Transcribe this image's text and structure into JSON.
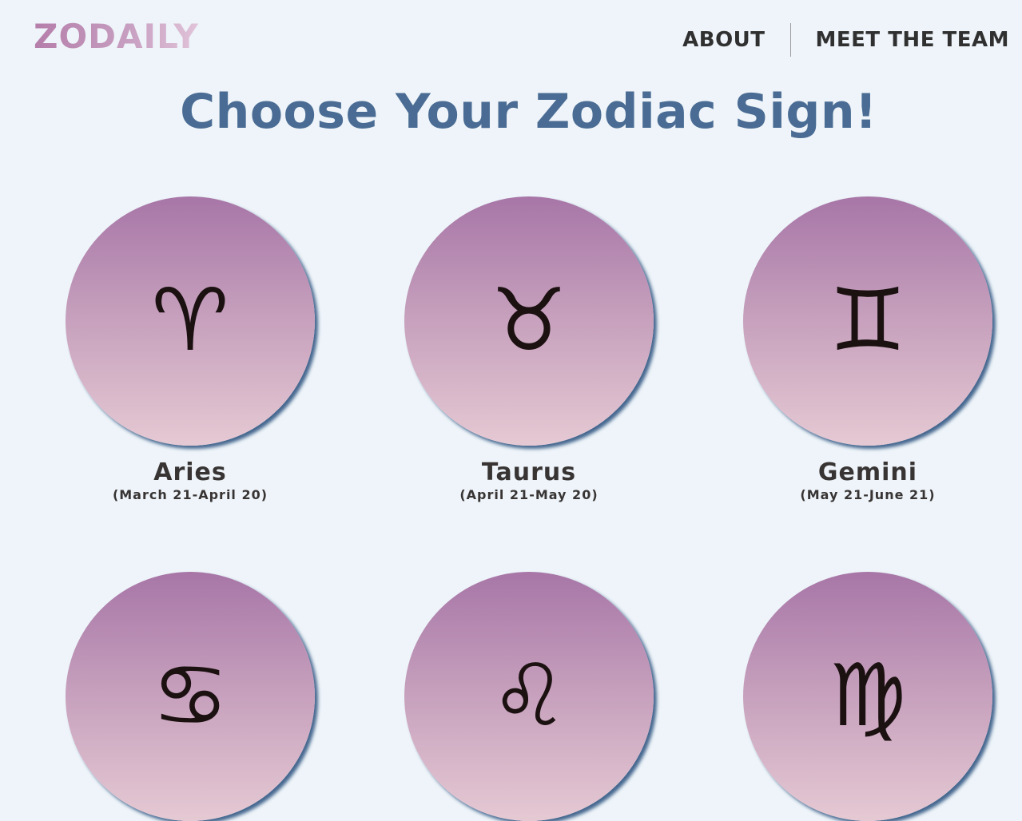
{
  "header": {
    "logo": "ZODAILY",
    "nav": [
      {
        "label": "ABOUT"
      },
      {
        "label": "MEET THE TEAM"
      }
    ]
  },
  "main": {
    "title": "Choose Your Zodiac Sign!",
    "signs": [
      {
        "name": "Aries",
        "dates": "(March 21-April 20)",
        "glyph": "♈︎",
        "icon": "aries-icon"
      },
      {
        "name": "Taurus",
        "dates": "(April 21-May 20)",
        "glyph": "♉︎",
        "icon": "taurus-icon"
      },
      {
        "name": "Gemini",
        "dates": "(May 21-June 21)",
        "glyph": "♊︎",
        "icon": "gemini-icon"
      },
      {
        "name": "",
        "dates": "",
        "glyph": "♋︎",
        "icon": "cancer-icon"
      },
      {
        "name": "",
        "dates": "",
        "glyph": "♌︎",
        "icon": "leo-icon"
      },
      {
        "name": "",
        "dates": "",
        "glyph": "♍︎",
        "icon": "virgo-icon"
      }
    ]
  },
  "colors": {
    "background": "#eef4f9",
    "title": "#4a6c94",
    "circle_top": "#a776a7",
    "circle_bottom": "#e5c9d3",
    "text": "#383434"
  }
}
